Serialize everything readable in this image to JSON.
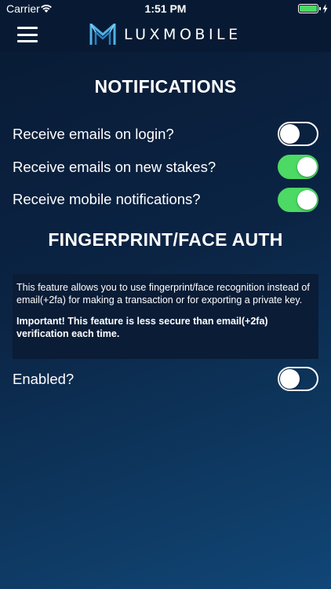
{
  "status_bar": {
    "carrier": "Carrier",
    "time": "1:51 PM",
    "battery_color": "#4cd964"
  },
  "nav": {
    "menu_icon": "hamburger-menu-icon",
    "logo_text": "LUXMOBILE",
    "logo_icon": "luxmobile-logo-icon"
  },
  "notifications": {
    "title": "NOTIFICATIONS",
    "items": [
      {
        "label": "Receive emails on login?",
        "enabled": false
      },
      {
        "label": "Receive emails on new stakes?",
        "enabled": true
      },
      {
        "label": "Receive mobile notifications?",
        "enabled": true
      }
    ]
  },
  "fingerprint": {
    "title": "FINGERPRINT/FACE AUTH",
    "description": "This feature allows you to use fingerprint/face recognition instead of email(+2fa) for making a transaction or for exporting a private key.",
    "warning": "Important! This feature is less secure than email(+2fa) verification each time.",
    "enabled_label": "Enabled?",
    "enabled": false
  },
  "colors": {
    "toggle_on": "#4cd964",
    "background_top": "#081a33",
    "background_bottom": "#114677"
  }
}
